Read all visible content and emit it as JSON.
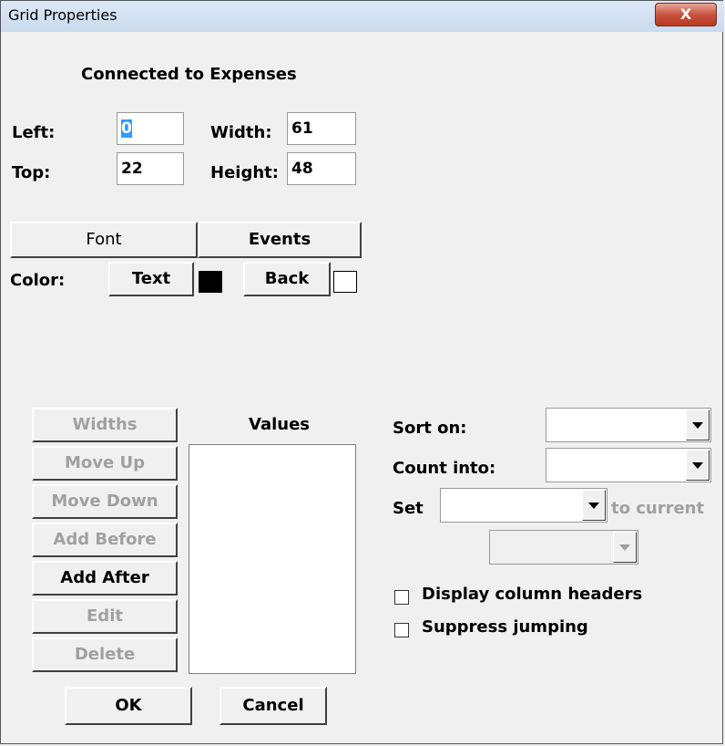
{
  "window": {
    "title": "Grid Properties",
    "close_label": "X"
  },
  "header": "Connected to Expenses",
  "position": {
    "left_label": "Left:",
    "left_value": "0",
    "top_label": "Top:",
    "top_value": "22",
    "width_label": "Width:",
    "width_value": "61",
    "height_label": "Height:",
    "height_value": "48"
  },
  "buttons": {
    "font": "Font",
    "events": "Events",
    "text": "Text",
    "back": "Back",
    "ok": "OK",
    "cancel": "Cancel"
  },
  "color": {
    "label": "Color:",
    "text_color": "#000000",
    "back_color": "#ffffff"
  },
  "column_buttons": {
    "widths": "Widths",
    "move_up": "Move Up",
    "move_down": "Move Down",
    "add_before": "Add Before",
    "add_after": "Add After",
    "edit": "Edit",
    "delete": "Delete"
  },
  "values": {
    "label": "Values"
  },
  "options": {
    "sort_on_label": "Sort on:",
    "sort_on_value": "",
    "count_into_label": "Count into:",
    "count_into_value": "",
    "set_label": "Set",
    "set_value": "",
    "to_current_label": "to current",
    "set_target_value": "",
    "display_headers_label": "Display column headers",
    "display_headers_checked": false,
    "suppress_jumping_label": "Suppress jumping",
    "suppress_jumping_checked": false
  }
}
